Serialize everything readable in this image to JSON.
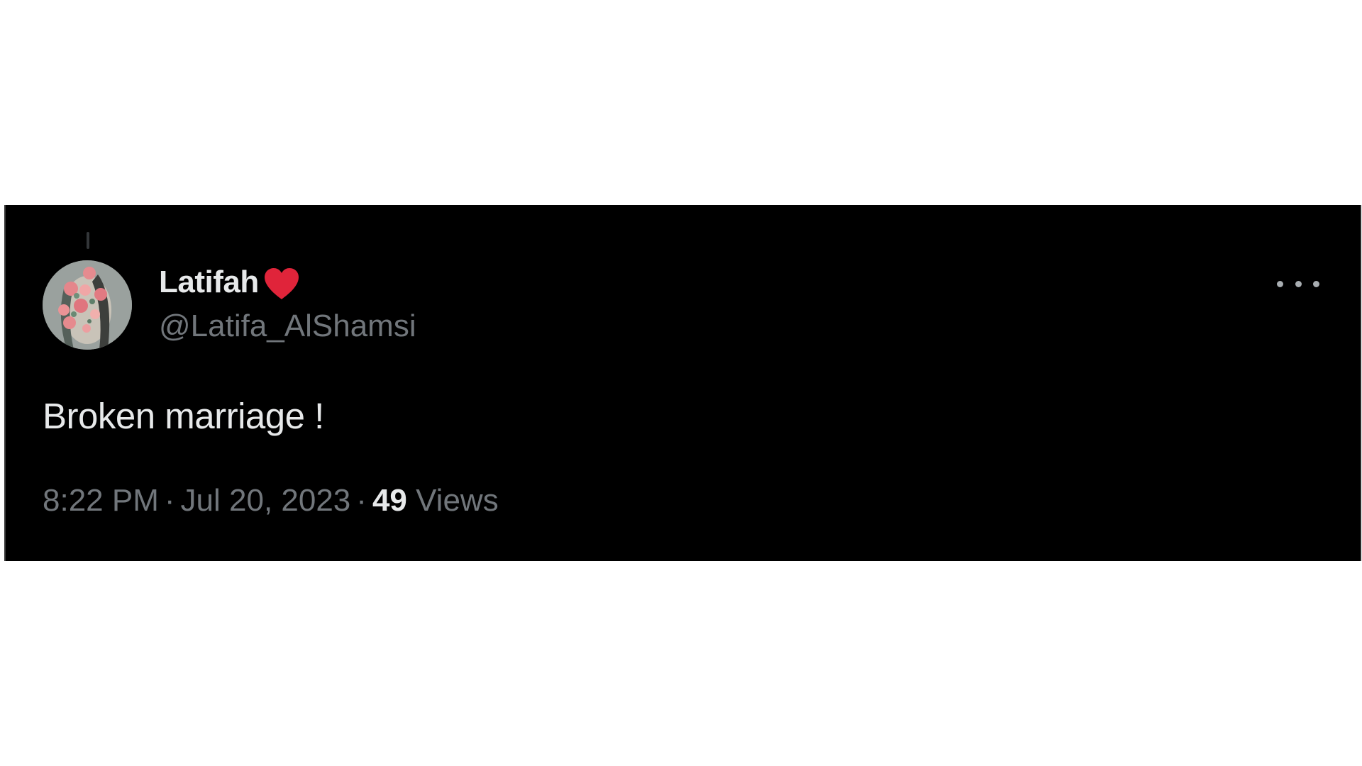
{
  "author": {
    "display_name": "Latifah",
    "badge_icon": "red-heart-icon",
    "handle": "@Latifa_AlShamsi"
  },
  "tweet": {
    "text": "Broken marriage !",
    "time": "8:22 PM",
    "separator": "·",
    "date": "Jul 20, 2023",
    "views_count": "49",
    "views_label": "Views"
  },
  "colors": {
    "background": "#000000",
    "primary_text": "#e7e9ea",
    "secondary_text": "#71767b",
    "heart": "#e0243a"
  }
}
